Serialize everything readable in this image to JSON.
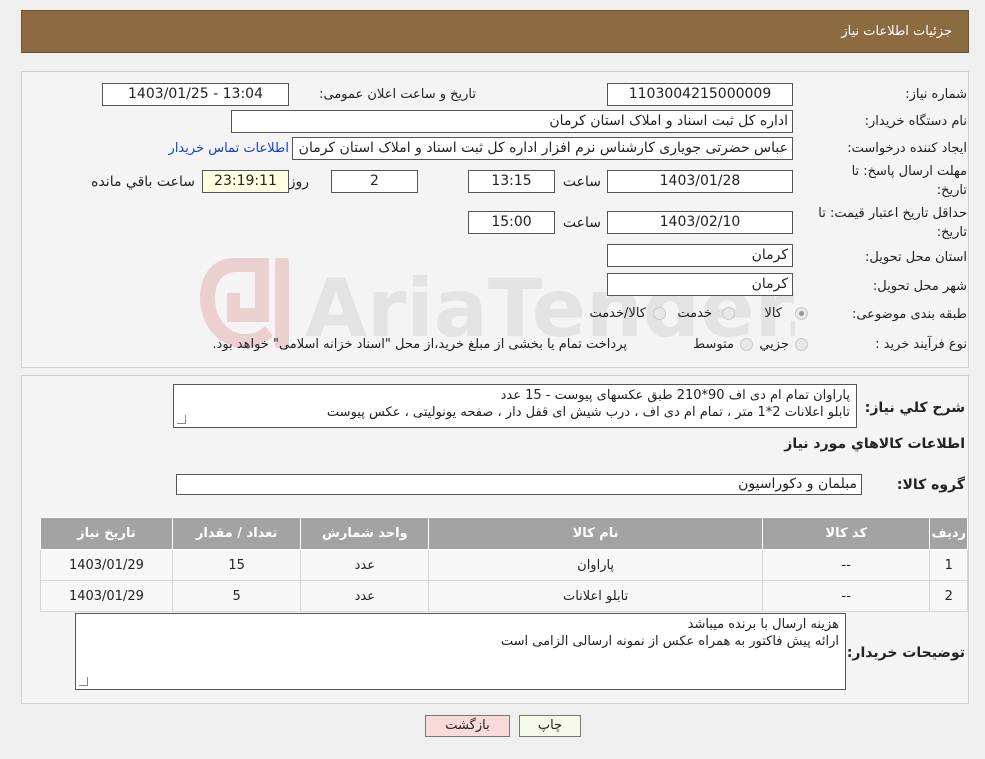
{
  "header": {
    "title": "جزئیات اطلاعات نیاز"
  },
  "form": {
    "need_number_label": "شماره نیاز:",
    "need_number": "1103004215000009",
    "announce_label": "تاریخ و ساعت اعلان عمومی:",
    "announce_value": "1403/01/25 - 13:04",
    "buyer_label": "نام دستگاه خریدار:",
    "buyer": "اداره کل ثبت اسناد و املاک استان کرمان",
    "creator_label": "ایجاد کننده درخواست:",
    "creator": "عباس حضرتی جویاری کارشناس نرم افزار اداره کل ثبت اسناد و املاک استان کرمان",
    "contact_link": "اطلاعات تماس خریدار",
    "deadline_label_1": "مهلت ارسال پاسخ: تا",
    "deadline_label_2": "تاریخ:",
    "deadline_date": "1403/01/28",
    "time_word": "ساعت",
    "deadline_time": "13:15",
    "days_value": "2",
    "days_word": "روز و",
    "remaining_value": "23:19:11",
    "remaining_word": "ساعت باقي مانده",
    "validity_label_1": "حداقل تاريخ اعتبار قيمت: تا",
    "validity_label_2": "تاريخ:",
    "validity_date": "1403/02/10",
    "validity_time": "15:00",
    "province_label": "استان محل تحویل:",
    "province": "کرمان",
    "city_label": "شهر محل تحویل:",
    "city": "کرمان",
    "category_label": "طبقه بندی موضوعی:",
    "category_options": [
      "کالا",
      "خدمت",
      "کالا/خدمت"
    ],
    "process_label": "نوع فرآیند خرید :",
    "process_options": [
      "جزيي",
      "متوسط"
    ],
    "process_note": "پرداخت تمام یا بخشی از مبلغ خرید،از محل \"اسناد خزانه اسلامی\" خواهد بود."
  },
  "description": {
    "label": "شرح کلي نياز:",
    "line1": "پاراوان تمام ام دی اف  90*210 طبق عکسهای پیوست - 15 عدد",
    "line2": "تابلو اعلانات 2*1 متر ، تمام ام دی اف ، درب شیش ای قفل دار ، صفحه یونولیتی ، عکس پیوست"
  },
  "goods_title": "اطلاعات کالاهاي مورد نياز",
  "goods_group": {
    "label": "گروه کالا:",
    "value": "مبلمان و دکوراسیون"
  },
  "table": {
    "headers": [
      "رديف",
      "کد کالا",
      "نام کالا",
      "واحد شمارش",
      "تعداد / مقدار",
      "تاریخ نیاز"
    ],
    "rows": [
      [
        "1",
        "--",
        "پاراوان",
        "عدد",
        "15",
        "1403/01/29"
      ],
      [
        "2",
        "--",
        "تابلو اعلانات",
        "عدد",
        "5",
        "1403/01/29"
      ]
    ]
  },
  "buyer_notes": {
    "label": "توضیحات خریدار:",
    "line1": "هزینه ارسال با برنده میباشد",
    "line2": "ارائه پیش فاکتور به همراه عکس از نمونه ارسالی الزامی است"
  },
  "buttons": {
    "print": "چاپ",
    "back": "بازگشت"
  },
  "watermark": {
    "text": "AriaTender.neT"
  },
  "colors": {
    "header": "#8b6b3f",
    "link": "#1a3fbf",
    "back_button": "#f9dada"
  }
}
